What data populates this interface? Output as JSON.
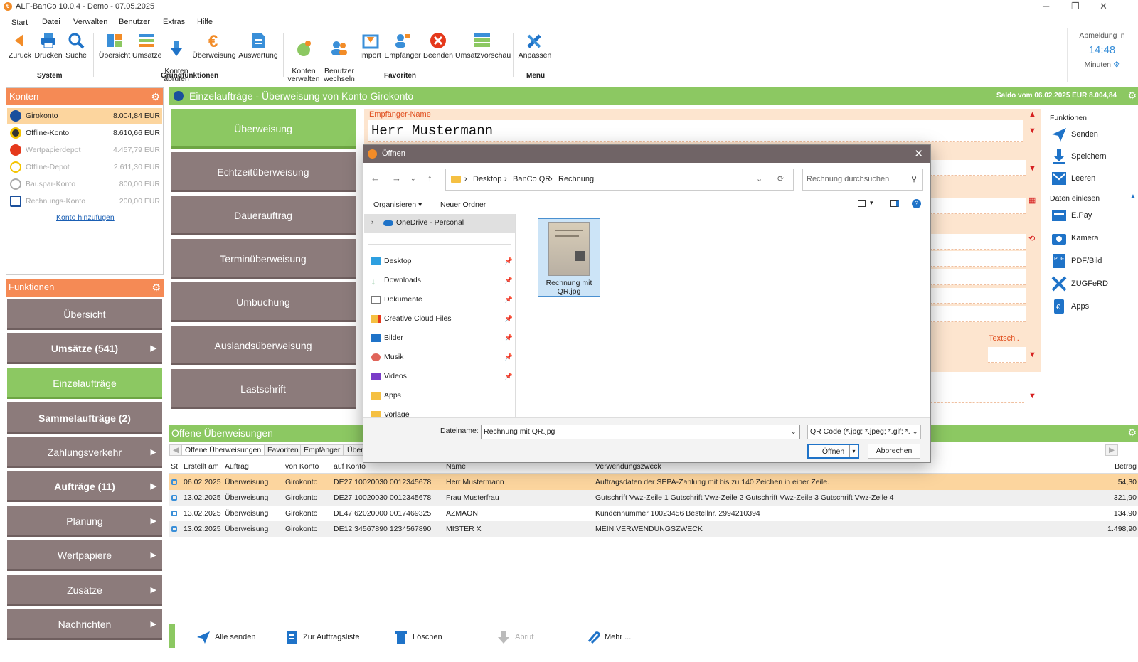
{
  "window": {
    "title": "ALF-BanCo 10.0.4 - Demo  -  07.05.2025"
  },
  "menu_tabs": [
    "Start",
    "Datei",
    "Verwalten",
    "Benutzer",
    "Extras",
    "Hilfe"
  ],
  "ribbon": {
    "system": {
      "label": "System",
      "buttons": [
        "Zurück",
        "Drucken",
        "Suche"
      ]
    },
    "grundfunktionen": {
      "label": "Grundfunktionen",
      "buttons": [
        "Übersicht",
        "Umsätze",
        "Konten\nabrufen",
        "Überweisung",
        "Auswertung"
      ]
    },
    "favoriten": {
      "label": "Favoriten",
      "buttons": [
        "Konten\nverwalten",
        "Benutzer\nwechseln",
        "Import",
        "Empfänger",
        "Beenden",
        "Umsatzvorschau"
      ]
    },
    "menu": {
      "label": "Menü",
      "buttons": [
        "Anpassen"
      ]
    },
    "logout": {
      "label": "Abmeldung in",
      "time": "14:48",
      "unit": "Minuten"
    }
  },
  "konten": {
    "title": "Konten",
    "items": [
      {
        "name": "Girokonto",
        "value": "8.004,84 EUR"
      },
      {
        "name": "Offline-Konto",
        "value": "8.610,66 EUR"
      },
      {
        "name": "Wertpapierdepot",
        "value": "4.457,79 EUR"
      },
      {
        "name": "Offline-Depot",
        "value": "2.611,30 EUR"
      },
      {
        "name": "Bauspar-Konto",
        "value": "800,00 EUR"
      },
      {
        "name": "Rechnungs-Konto",
        "value": "200,00 EUR"
      }
    ],
    "add_link": "Konto hinzufügen"
  },
  "funktionen": {
    "title": "Funktionen",
    "items": [
      "Übersicht",
      "Umsätze (541)",
      "Einzelaufträge",
      "Sammelaufträge (2)",
      "Zahlungsverkehr",
      "Aufträge (11)",
      "Planung",
      "Wertpapiere",
      "Zusätze",
      "Nachrichten"
    ]
  },
  "center": {
    "title": "Einzelaufträge - Überweisung von Konto Girokonto",
    "saldo": "Saldo vom 06.02.2025 EUR 8.004,84",
    "order_types": [
      "Überweisung",
      "Echtzeitüberweisung",
      "Dauerauftrag",
      "Terminüberweisung",
      "Umbuchung",
      "Auslandsüberweisung",
      "Lastschrift"
    ],
    "empfaenger_label": "Empfänger-Name",
    "empfaenger_value": "Herr Mustermann",
    "textschl": "Textschl."
  },
  "right_functions": {
    "title": "Funktionen",
    "items": [
      "Senden",
      "Speichern",
      "Leeren"
    ],
    "daten_title": "Daten einlesen",
    "daten_items": [
      "E.Pay",
      "Kamera",
      "PDF/Bild",
      "ZUGFeRD",
      "Apps"
    ]
  },
  "offene": {
    "title": "Offene Überweisungen",
    "tabs": [
      "Offene Überweisungen",
      "Favoriten",
      "Empfänger",
      "Über"
    ],
    "columns": [
      "St",
      "Erstellt am",
      "Auftrag",
      "von Konto",
      "auf Konto",
      "Name",
      "Verwendungszweck",
      "Betrag"
    ],
    "rows": [
      {
        "date": "06.02.2025",
        "auftrag": "Überweisung",
        "von": "Girokonto",
        "auf": "DE27 10020030 0012345678",
        "name": "Herr Mustermann",
        "zweck": "Auftragsdaten der SEPA-Zahlung mit bis zu 140 Zeichen in einer Zeile.",
        "betrag": "54,30"
      },
      {
        "date": "13.02.2025",
        "auftrag": "Überweisung",
        "von": "Girokonto",
        "auf": "DE27 10020030 0012345678",
        "name": "Frau Musterfrau",
        "zweck": "Gutschrift Vwz-Zeile 1 Gutschrift Vwz-Zeile 2 Gutschrift Vwz-Zeile 3 Gutschrift Vwz-Zeile 4",
        "betrag": "321,90"
      },
      {
        "date": "13.02.2025",
        "auftrag": "Überweisung",
        "von": "Girokonto",
        "auf": "DE47 62020000 0017469325",
        "name": "AZMAON",
        "zweck": "Kundennummer 10023456 Bestellnr. 2994210394",
        "betrag": "134,90"
      },
      {
        "date": "13.02.2025",
        "auftrag": "Überweisung",
        "von": "Girokonto",
        "auf": "DE12 34567890 1234567890",
        "name": "MISTER X",
        "zweck": "MEIN VERWENDUNGSZWECK",
        "betrag": "1.498,90"
      }
    ]
  },
  "bottom_toolbar": [
    "Alle senden",
    "Zur Auftragsliste",
    "Löschen",
    "Abruf",
    "Mehr ..."
  ],
  "dialog": {
    "title": "Öffnen",
    "path": [
      "Desktop",
      "BanCo QR",
      "Rechnung"
    ],
    "search_placeholder": "Rechnung durchsuchen",
    "organize": "Organisieren",
    "new_folder": "Neuer Ordner",
    "nav_items": [
      "OneDrive - Personal",
      "Desktop",
      "Downloads",
      "Dokumente",
      "Creative Cloud Files",
      "Bilder",
      "Musik",
      "Videos",
      "Apps",
      "Vorlage"
    ],
    "file": "Rechnung mit QR.jpg",
    "filename_label": "Dateiname:",
    "filename_value": "Rechnung mit QR.jpg",
    "filetype": "QR Code  (*.jpg; *.jpeg; *.gif; *.",
    "open_btn": "Öffnen",
    "cancel_btn": "Abbrechen"
  },
  "colors": {
    "green": "#8cc862",
    "orange": "#f58a55",
    "taupe": "#8c7b7b",
    "selected": "#fcd59e",
    "form_bg": "#fde5cf"
  }
}
